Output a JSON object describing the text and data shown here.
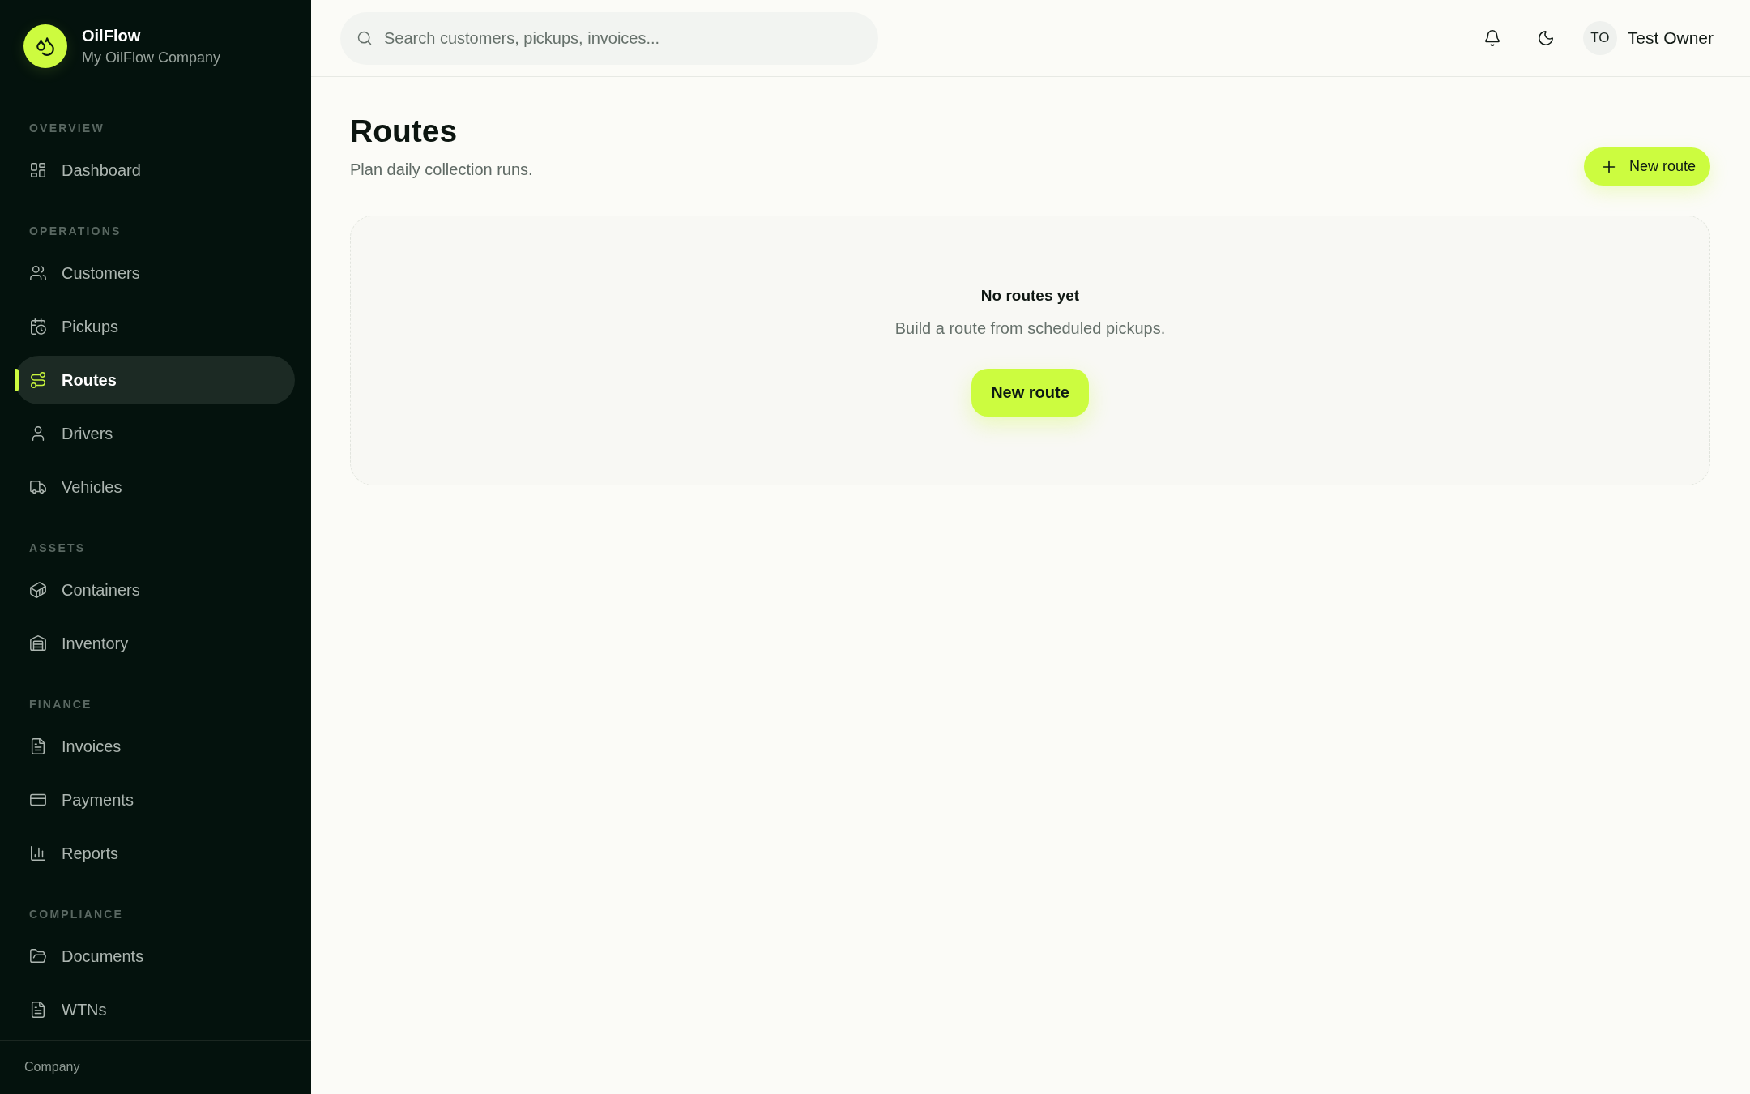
{
  "brand": {
    "name": "OilFlow",
    "company": "My OilFlow Company"
  },
  "sidebar": {
    "sections": [
      {
        "title": "OVERVIEW",
        "items": [
          {
            "label": "Dashboard",
            "selected": false
          }
        ]
      },
      {
        "title": "OPERATIONS",
        "items": [
          {
            "label": "Customers",
            "selected": false
          },
          {
            "label": "Pickups",
            "selected": false
          },
          {
            "label": "Routes",
            "selected": true
          },
          {
            "label": "Drivers",
            "selected": false
          },
          {
            "label": "Vehicles",
            "selected": false
          }
        ]
      },
      {
        "title": "ASSETS",
        "items": [
          {
            "label": "Containers",
            "selected": false
          },
          {
            "label": "Inventory",
            "selected": false
          }
        ]
      },
      {
        "title": "FINANCE",
        "items": [
          {
            "label": "Invoices",
            "selected": false
          },
          {
            "label": "Payments",
            "selected": false
          },
          {
            "label": "Reports",
            "selected": false
          }
        ]
      },
      {
        "title": "COMPLIANCE",
        "items": [
          {
            "label": "Documents",
            "selected": false
          },
          {
            "label": "WTNs",
            "selected": false
          }
        ]
      }
    ],
    "footer": "Company"
  },
  "topbar": {
    "search": {
      "placeholder": "Search customers, pickups, invoices..."
    },
    "user": {
      "initials": "TO",
      "name": "Test Owner"
    }
  },
  "page": {
    "title": "Routes",
    "subtitle": "Plan daily collection runs.",
    "primary_button": "New route"
  },
  "empty_state": {
    "title": "No routes yet",
    "message": "Build a route from scheduled pickups.",
    "button": "New route"
  }
}
